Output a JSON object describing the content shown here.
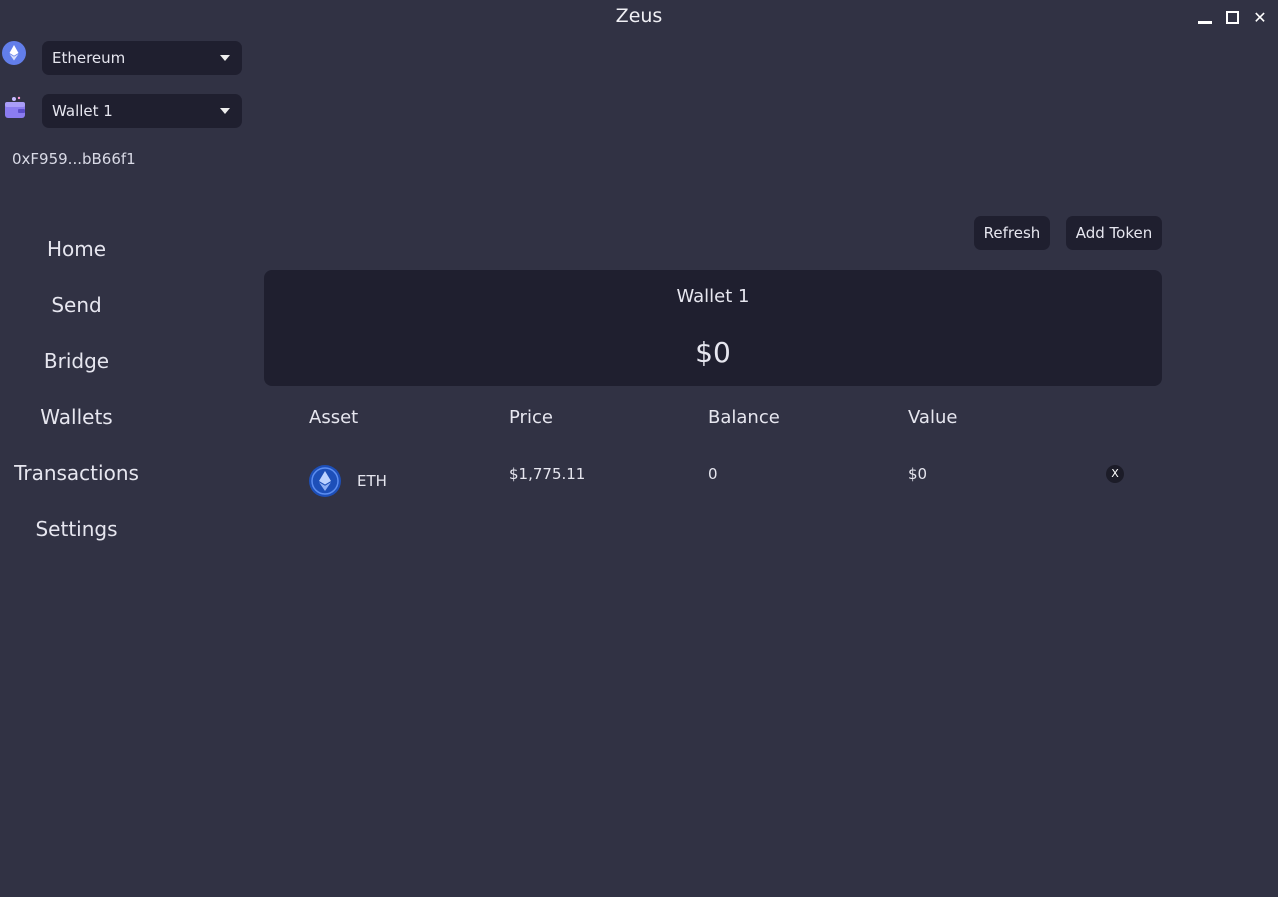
{
  "window": {
    "title": "Zeus"
  },
  "sidebar": {
    "network_select": {
      "value": "Ethereum",
      "icon": "ethereum-icon"
    },
    "wallet_select": {
      "value": "Wallet 1",
      "icon": "wallet-icon"
    },
    "address": "0xF959...bB66f1",
    "nav": [
      "Home",
      "Send",
      "Bridge",
      "Wallets",
      "Transactions",
      "Settings"
    ]
  },
  "toolbar": {
    "refresh_label": "Refresh",
    "add_token_label": "Add Token"
  },
  "wallet_card": {
    "name": "Wallet 1",
    "total": "$0"
  },
  "table": {
    "headers": [
      "Asset",
      "Price",
      "Balance",
      "Value"
    ],
    "rows": [
      {
        "asset": "ETH",
        "price": "$1,775.11",
        "balance": "0",
        "value": "$0",
        "remove_label": "X",
        "icon": "eth-token-icon"
      }
    ]
  },
  "colors": {
    "background": "#313244",
    "panel": "#1f1f2f",
    "accent": "#627eea"
  }
}
